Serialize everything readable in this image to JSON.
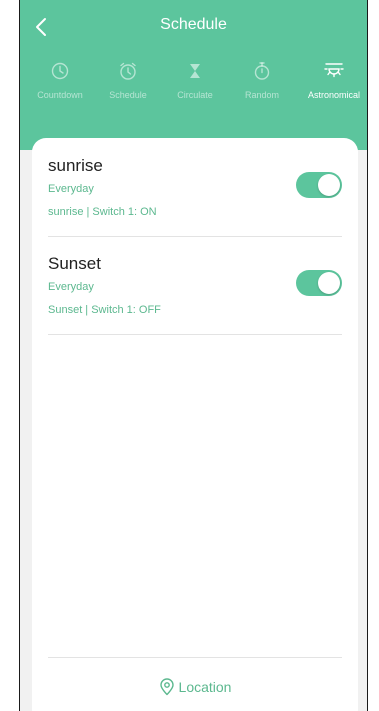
{
  "header": {
    "title": "Schedule",
    "background_color": "#5cc59d",
    "tabs": [
      {
        "label": "Countdown",
        "icon": "clock-icon",
        "active": false
      },
      {
        "label": "Schedule",
        "icon": "alarm-clock-icon",
        "active": false
      },
      {
        "label": "Circulate",
        "icon": "hourglass-icon",
        "active": false
      },
      {
        "label": "Random",
        "icon": "stopwatch-icon",
        "active": false
      },
      {
        "label": "Astronomical",
        "icon": "sunrise-icon",
        "active": true
      }
    ]
  },
  "schedules": [
    {
      "name": "sunrise",
      "repeat": "Everyday",
      "action": "sunrise  | Switch 1: ON",
      "enabled": true
    },
    {
      "name": "Sunset",
      "repeat": "Everyday",
      "action": "Sunset  | Switch 1: OFF",
      "enabled": true
    }
  ],
  "footer": {
    "location_label": "Location",
    "icon": "location-pin-icon"
  },
  "colors": {
    "accent": "#5cc59d",
    "text_accent": "#5cb88f"
  }
}
